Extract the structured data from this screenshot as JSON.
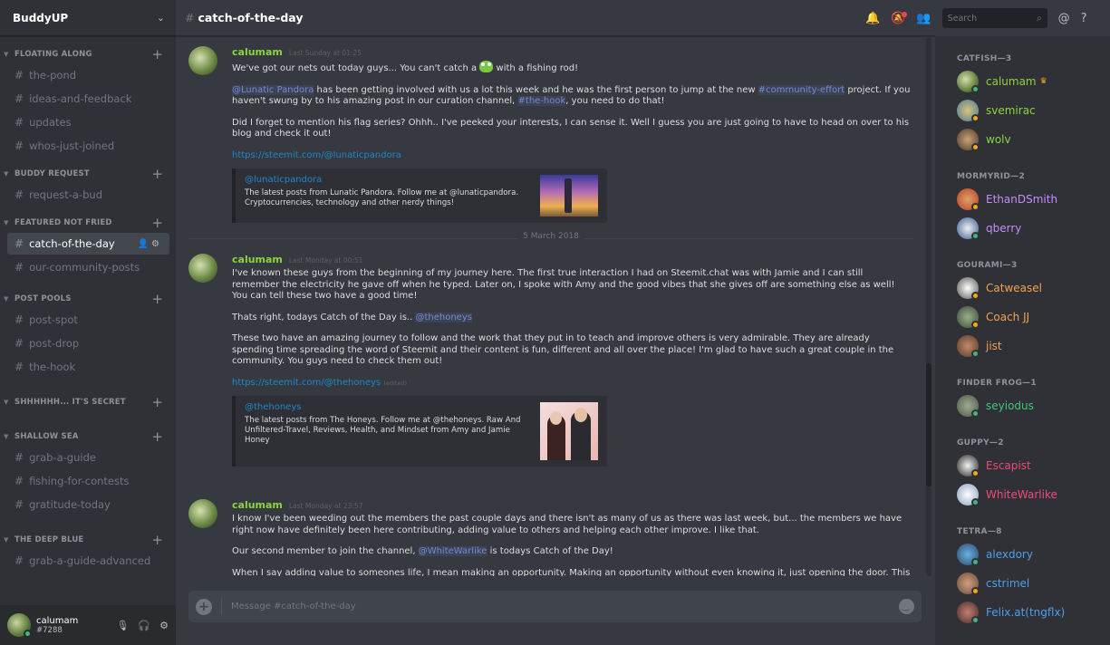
{
  "server": {
    "name": "BuddyUP"
  },
  "sidebar": {
    "categories": [
      {
        "name": "FLOATING ALONG",
        "channels": [
          "the-pond",
          "ideas-and-feedback",
          "updates",
          "whos-just-joined"
        ]
      },
      {
        "name": "BUDDY REQUEST",
        "channels": [
          "request-a-bud"
        ]
      },
      {
        "name": "FEATURED NOT FRIED",
        "channels": [
          "catch-of-the-day",
          "our-community-posts"
        ]
      },
      {
        "name": "POST POOLS",
        "channels": [
          "post-spot",
          "post-drop",
          "the-hook"
        ]
      },
      {
        "name": "SHHHHHH... IT'S SECRET",
        "channels": []
      },
      {
        "name": "SHALLOW SEA",
        "channels": [
          "grab-a-guide",
          "fishing-for-contests",
          "gratitude-today"
        ]
      },
      {
        "name": "THE DEEP BLUE",
        "channels": [
          "grab-a-guide-advanced"
        ]
      }
    ]
  },
  "user_panel": {
    "username": "calumam",
    "discriminator": "#7288"
  },
  "channel": {
    "name": "catch-of-the-day"
  },
  "header": {
    "search_placeholder": "Search"
  },
  "messages": [
    {
      "author": "calumam",
      "timestamp": "Last Sunday at 01:25",
      "p1a": "We've got our nets out today guys... You can't catch a ",
      "p1b": " with a fishing rod!",
      "p2_mention": "@Lunatic Pandora",
      "p2a": " has been getting involved with us a lot this week and he was the first person to jump at the new ",
      "p2_chan": "#community-effort",
      "p2b": " project. If you haven't swung by to his amazing post in our curation channel, ",
      "p2_chan2": "#the-hook",
      "p2c": ", you need to do that!",
      "p3": "Did I forget to mention his flag series? Ohhh.. I've peeked your interests, I can sense it. Well I guess you are just going to have to head on over to his blog and check it out!",
      "link": "https://steemit.com/@lunaticpandora",
      "embed_title": "@lunaticpandora",
      "embed_desc": "The latest posts from Lunatic Pandora. Follow me at @lunaticpandora. Cryptocurrencies, technology and other nerdy things!"
    },
    {
      "author": "calumam",
      "timestamp": "Last Monday at 00:51",
      "p1": "I've known these guys from the beginning of my journey here. The first true interaction I had on Steemit.chat was with Jamie and I can still remember the electricity he gave off when he typed. Later on, I spoke with Amy and the good vibes that she gives off are something else as well! You can tell these two have a good time!",
      "p2a": "Thats right, todays Catch of the Day is.. ",
      "p2_mention": "@thehoneys",
      "p3": "These two have an amazing journey to follow and the work that they put in to teach and improve others is very admirable. They are already spending time spreading the word of Steemit and their content is fun, different and all over the place! I'm glad to have such a great couple in the community. You guys need to check them out!",
      "link": "https://steemit.com/@thehoneys",
      "edited": "(edited)",
      "embed_title": "@thehoneys",
      "embed_desc": "The latest posts from The Honeys. Follow me at @thehoneys. Raw And Unfiltered-Travel, Reviews, Health, and Mindset from Amy and Jamie Honey"
    },
    {
      "author": "calumam",
      "timestamp": "Last Monday at 23:57",
      "p1": "I know I've been weeding out the members the past couple days and there isn't as many of us as there was last week, but... the members we have right now have definitely been here contributing, adding value to others and helping each other improve. I like that.",
      "p2a": "Our second member to join the channel, ",
      "p2_mention": "@WhiteWarlike",
      "p2b": "  is todays Catch of the Day!",
      "p3": "When I say adding value to someones life, I mean making an opportunity. Making an opportunity without even knowing it, just opening the door. This guy opened"
    }
  ],
  "date_divider": "5 March 2018",
  "composer": {
    "placeholder": "Message #catch-of-the-day"
  },
  "members": {
    "groups": [
      {
        "role": "CATFISH—3",
        "members": [
          {
            "name": "calumam",
            "color": "#8bd43f",
            "status": "#43b581",
            "crown": true
          },
          {
            "name": "svemirac",
            "color": "#8bd43f",
            "status": "#faa61a"
          },
          {
            "name": "wolv",
            "color": "#8bd43f",
            "status": "#faa61a"
          }
        ]
      },
      {
        "role": "MORMYRID—2",
        "members": [
          {
            "name": "EthanDSmith",
            "color": "#c38cff",
            "status": "#faa61a"
          },
          {
            "name": "qberry",
            "color": "#c38cff",
            "status": "#43b581"
          }
        ]
      },
      {
        "role": "GOURAMI—3",
        "members": [
          {
            "name": "Catweasel",
            "color": "#f4a150",
            "status": "#faa61a"
          },
          {
            "name": "Coach JJ",
            "color": "#f4a150",
            "status": "#faa61a"
          },
          {
            "name": "jist",
            "color": "#f4a150",
            "status": "#43b581"
          }
        ]
      },
      {
        "role": "FINDER FROG—1",
        "members": [
          {
            "name": "seyiodus",
            "color": "#43c579",
            "status": "#43b581"
          }
        ]
      },
      {
        "role": "GUPPY—2",
        "members": [
          {
            "name": "Escapist",
            "color": "#f04a7a",
            "status": "#faa61a"
          },
          {
            "name": "WhiteWarlike",
            "color": "#f04a7a",
            "status": "#43b581"
          }
        ]
      },
      {
        "role": "TETRA—8",
        "members": [
          {
            "name": "alexdory",
            "color": "#4f9fe8",
            "status": "#43b581"
          },
          {
            "name": "cstrimel",
            "color": "#4f9fe8",
            "status": "#faa61a"
          },
          {
            "name": "Felix.at(tngflx)",
            "color": "#4f9fe8",
            "status": "#43b581"
          }
        ]
      }
    ]
  }
}
